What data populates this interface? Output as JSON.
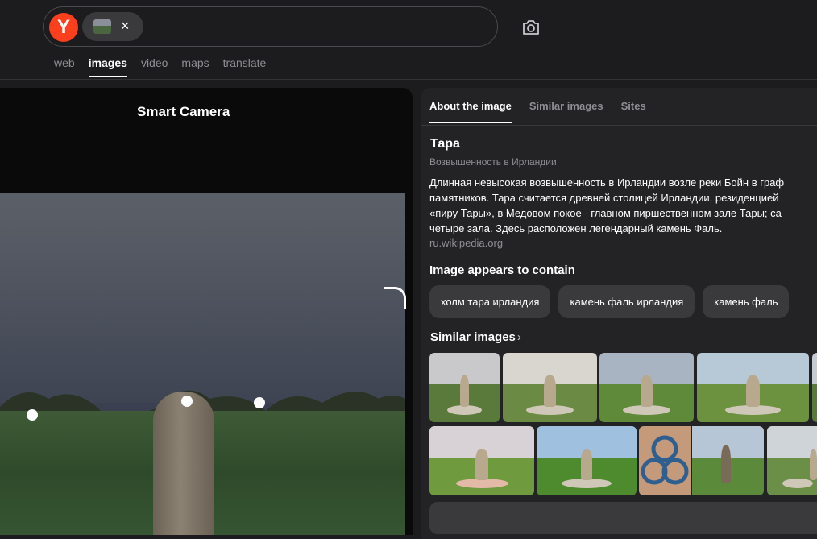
{
  "search": {
    "logo_letter": "Y",
    "clear_symbol": "×"
  },
  "nav_tabs": [
    "web",
    "images",
    "video",
    "maps",
    "translate"
  ],
  "left_panel": {
    "title": "Smart Camera"
  },
  "right_panel": {
    "tabs": [
      "About the image",
      "Similar images",
      "Sites"
    ],
    "entity": {
      "title": "Тара",
      "subtitle": "Возвышенность в Ирландии",
      "description_lines": [
        "Длинная невысокая возвышенность в Ирландии возле реки Бойн в граф",
        "памятников. Тара считается древней столицей Ирландии, резиденцией",
        "«пиру Тары», в Медовом покое - главном пиршественном зале Тары; са",
        "четыре зала. Здесь расположен легендарный камень Фаль."
      ],
      "source": "ru.wikipedia.org"
    },
    "contains_heading": "Image appears to contain",
    "contains_tags": [
      "холм тара ирландия",
      "камень фаль ирландия",
      "камень фаль"
    ],
    "similar_heading": "Similar images",
    "similar_chevron": "›"
  },
  "colors": {
    "brand": "#fc3f1d",
    "background": "#1c1c1e",
    "panel": "#232326",
    "chip": "#3a3a3d",
    "muted_text": "#8e8e93"
  }
}
